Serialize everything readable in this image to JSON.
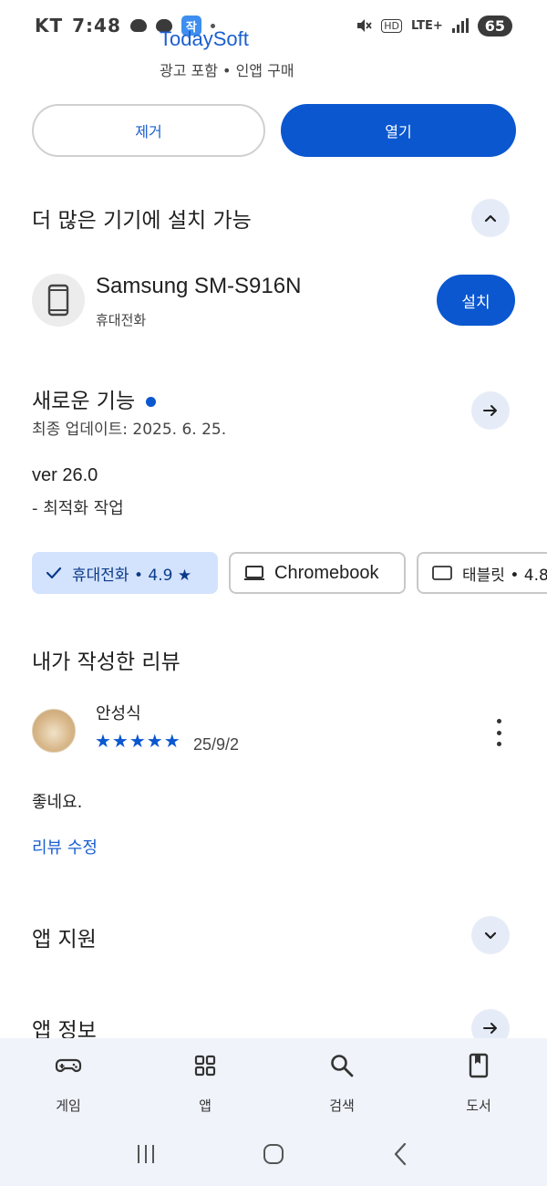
{
  "status_bar": {
    "carrier": "KT",
    "time": "7:48",
    "app_badge": "작",
    "network": "LTE+",
    "hd": "HD",
    "battery": "65"
  },
  "app": {
    "name": "TodaySoft",
    "meta": "광고 포함 • 인앱 구매"
  },
  "actions": {
    "remove_label": "제거",
    "open_label": "열기"
  },
  "devices_section": {
    "title": "더 많은 기기에 설치 가능",
    "device_name": "Samsung SM-S916N",
    "device_type": "휴대전화",
    "install_label": "설치"
  },
  "whats_new": {
    "title": "새로운 기능",
    "last_updated": "최종 업데이트: 2025. 6. 25.",
    "version": "ver 26.0",
    "notes": "- 최적화 작업"
  },
  "rating_chips": [
    {
      "label": "휴대전화 • 4.9 ★",
      "icon": "check-icon",
      "selected": true
    },
    {
      "label": "Chromebook",
      "icon": "laptop-icon",
      "selected": false
    },
    {
      "label": "태블릿 • 4.8",
      "icon": "tablet-icon",
      "selected": false
    }
  ],
  "my_review": {
    "title": "내가 작성한 리뷰",
    "reviewer": "안성식",
    "stars": "★★★★★",
    "rating": 5,
    "date": "25/9/2",
    "text": "좋네요.",
    "edit_label": "리뷰 수정"
  },
  "app_support": {
    "title": "앱 지원"
  },
  "app_info": {
    "title": "앱 정보"
  },
  "bottom_nav": {
    "items": [
      {
        "label": "게임",
        "icon": "gamepad-icon"
      },
      {
        "label": "앱",
        "icon": "apps-grid-icon"
      },
      {
        "label": "검색",
        "icon": "search-icon"
      },
      {
        "label": "도서",
        "icon": "book-icon"
      }
    ]
  },
  "colors": {
    "accent": "#0b57d0",
    "chip_selected": "#d3e3fd",
    "nav_bg": "#f0f3fa"
  }
}
